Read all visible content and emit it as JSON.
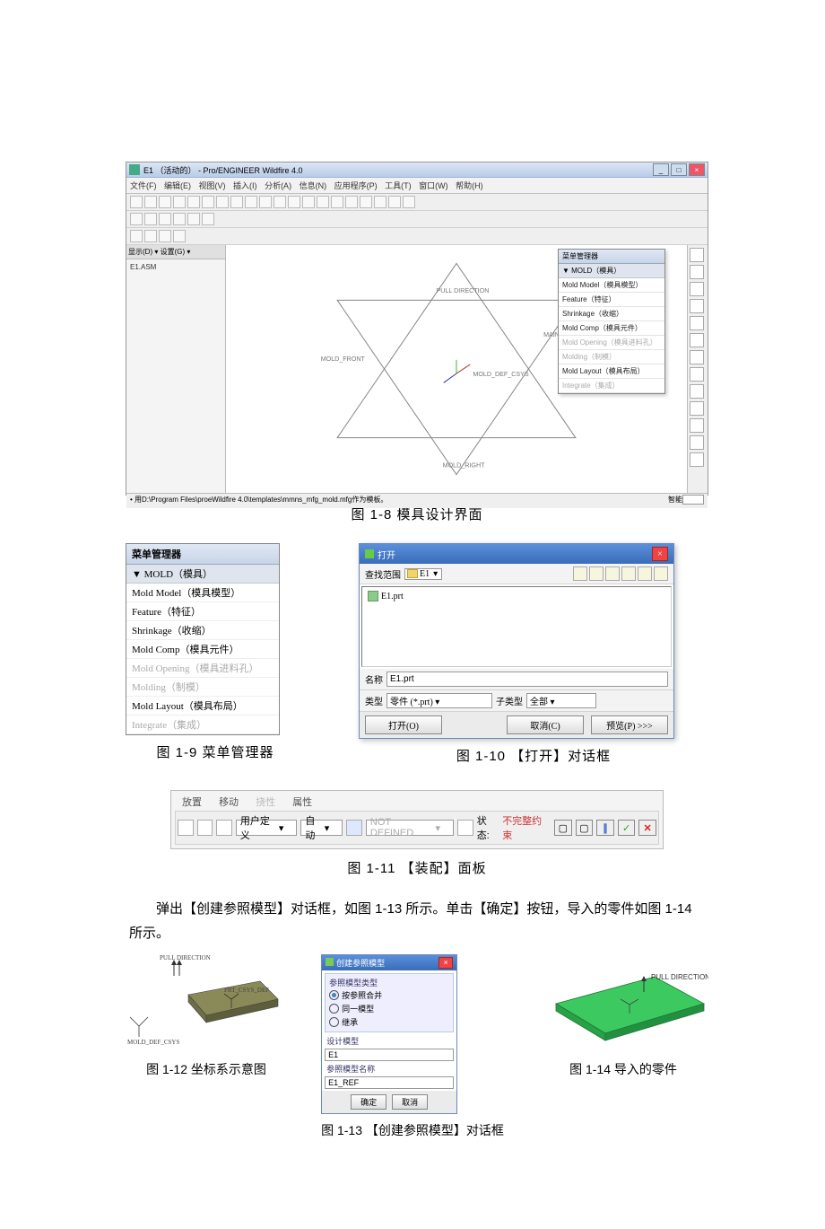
{
  "app": {
    "title": "E1 （活动的） - Pro/ENGINEER Wildfire 4.0",
    "menubar": [
      "文件(F)",
      "编辑(E)",
      "视图(V)",
      "插入(I)",
      "分析(A)",
      "信息(N)",
      "应用程序(P)",
      "工具(T)",
      "窗口(W)",
      "帮助(H)"
    ],
    "tree_tabs": "显示(D) ▾   设置(G) ▾",
    "tree_root": "E1.ASM",
    "viewport_labels": {
      "pull": "PULL DIRECTION",
      "front": "MOLD_FRONT",
      "parting": "MAIN_PARTING_PLN",
      "csys": "MOLD_DEF_CSYS",
      "right": "MOLD_RIGHT"
    },
    "status_left": "• 用D:\\Program Files\\proeWildfire 4.0\\templates\\mmns_mfg_mold.mfg作为模板。",
    "status_right_label": "智能",
    "menu_mgr": {
      "title": "菜单管理器",
      "section": "▼ MOLD（模具）",
      "items": [
        {
          "t": "Mold Model（模具模型）",
          "dis": false
        },
        {
          "t": "Feature（特征）",
          "dis": false
        },
        {
          "t": "Shrinkage（收缩）",
          "dis": false
        },
        {
          "t": "Mold Comp（模具元件）",
          "dis": false
        },
        {
          "t": "Mold Opening（模具进料孔）",
          "dis": true
        },
        {
          "t": "Molding（制模）",
          "dis": true
        },
        {
          "t": "Mold Layout（模具布局）",
          "dis": false
        },
        {
          "t": "Integrate（集成）",
          "dis": true
        }
      ]
    }
  },
  "captions": {
    "c18": "图 1-8    模具设计界面",
    "c19": "图 1-9    菜单管理器",
    "c110": "图 1-10   【打开】对话框",
    "c111": "图 1-11   【装配】面板",
    "c112": "图 1-12    坐标系示意图",
    "c113": "图 1-13   【创建参照模型】对话框",
    "c114": "图 1-14    导入的零件"
  },
  "open_dialog": {
    "title": "打开",
    "lookin_label": "查找范围",
    "lookin_value": "E1",
    "file_item": "E1.prt",
    "name_label": "名称",
    "name_value": "E1.prt",
    "type_label": "类型",
    "type_value": "零件 (*.prt)",
    "subtype_label": "子类型",
    "subtype_value": "全部",
    "btn_open": "打开(O)",
    "btn_cancel": "取消(C)",
    "btn_preview": "预览(P) >>>"
  },
  "asm_panel": {
    "tabs": [
      {
        "t": "放置",
        "dis": false
      },
      {
        "t": "移动",
        "dis": false
      },
      {
        "t": "挠性",
        "dis": true
      },
      {
        "t": "属性",
        "dis": false
      }
    ],
    "dd_userdef": "用户定义",
    "dd_auto": "自动",
    "dd_notdef": "NOT DEFINED",
    "status_label": "状态:",
    "status_value": "不完整约束"
  },
  "para_text": "弹出【创建参照模型】对话框，如图 1-13 所示。单击【确定】按钮，导入的零件如图 1-14 所示。",
  "csys": {
    "pull": "PULL DIRECTION",
    "csys": "MOLD_DEF_CSYS",
    "prt": "PRT_CSYS_DEF"
  },
  "ref_dialog": {
    "title": "创建参照模型",
    "grp1": "参照模型类型",
    "opt1": "按参照合并",
    "opt2": "同一模型",
    "opt3": "继承",
    "grp2": "设计模型",
    "design_name": "E1",
    "grp3": "参照模型名称",
    "ref_name": "E1_REF",
    "btn_ok": "确定",
    "btn_cancel": "取消"
  },
  "green_part": {
    "label": "PULL DIRECTION"
  }
}
